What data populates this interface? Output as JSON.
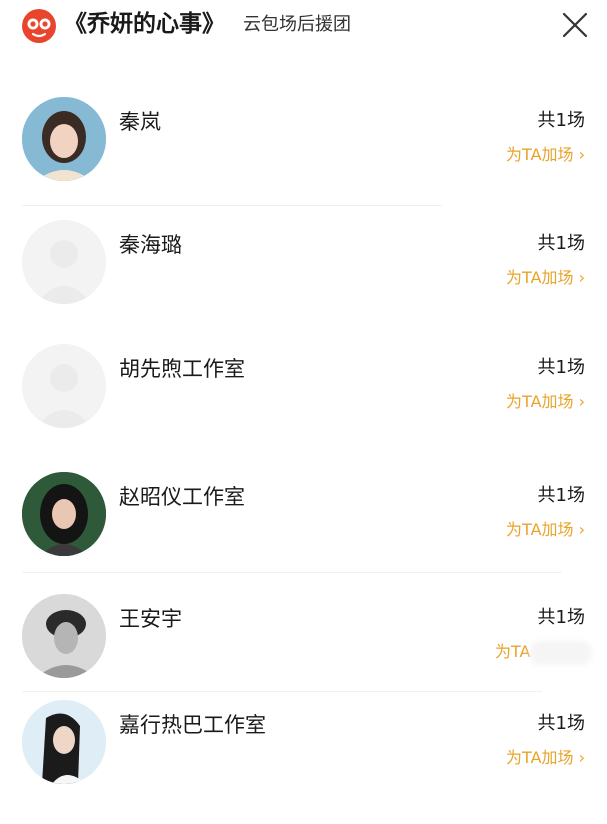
{
  "header": {
    "title": "《乔妍的心事》",
    "subtitle": "云包场后援团"
  },
  "rows": [
    {
      "name": "秦岚",
      "count": "共1场",
      "action": "为TA加场 ›"
    },
    {
      "name": "秦海璐",
      "count": "共1场",
      "action": "为TA加场 ›"
    },
    {
      "name": "胡先煦工作室",
      "count": "共1场",
      "action": "为TA加场 ›"
    },
    {
      "name": "赵昭仪工作室",
      "count": "共1场",
      "action": "为TA加场 ›"
    },
    {
      "name": "王安宇",
      "count": "共1场",
      "action": "为TA"
    },
    {
      "name": "嘉行热巴工作室",
      "count": "共1场",
      "action": "为TA加场 ›"
    }
  ],
  "colors": {
    "accent": "#e8a32a",
    "logo": "#e8452c"
  }
}
